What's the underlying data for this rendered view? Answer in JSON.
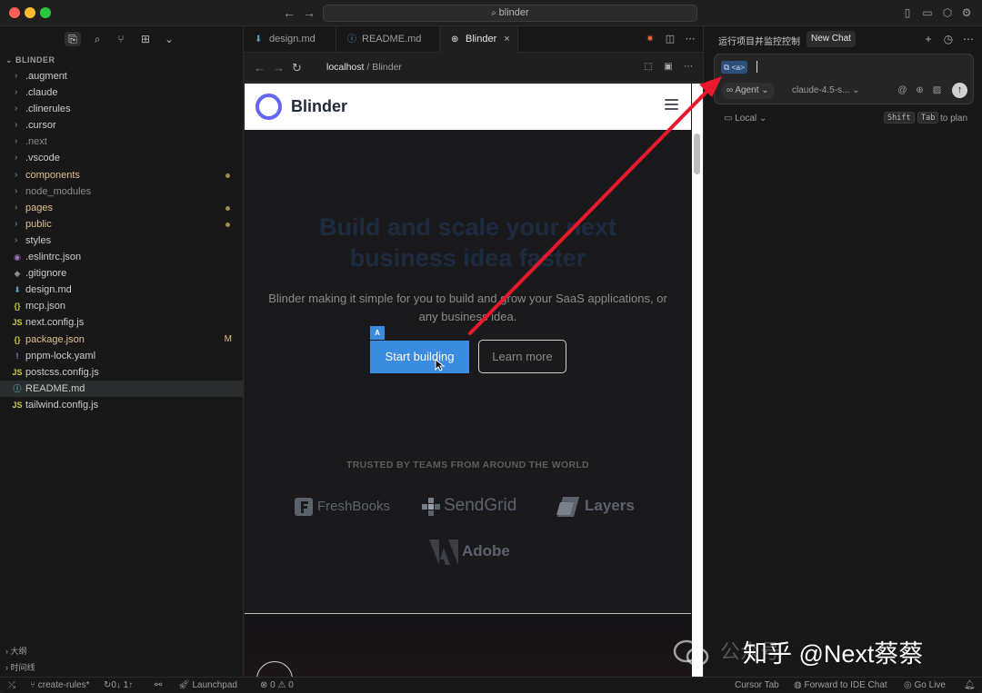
{
  "titlebar": {
    "search_text": "blinder"
  },
  "sidebar": {
    "header": "BLINDER",
    "items": [
      {
        "label": ".augment",
        "kind": "folder",
        "state": ""
      },
      {
        "label": ".claude",
        "kind": "folder",
        "state": ""
      },
      {
        "label": ".clinerules",
        "kind": "folder",
        "state": ""
      },
      {
        "label": ".cursor",
        "kind": "folder",
        "state": ""
      },
      {
        "label": ".next",
        "kind": "folder",
        "state": "dim"
      },
      {
        "label": ".vscode",
        "kind": "folder",
        "state": ""
      },
      {
        "label": "components",
        "kind": "folder",
        "state": "mod"
      },
      {
        "label": "node_modules",
        "kind": "folder",
        "state": "dim"
      },
      {
        "label": "pages",
        "kind": "folder",
        "state": "mod"
      },
      {
        "label": "public",
        "kind": "folder",
        "state": "mod"
      },
      {
        "label": "styles",
        "kind": "folder",
        "state": ""
      },
      {
        "label": ".eslintrc.json",
        "kind": "file",
        "icon": "◉",
        "icon_color": "#a074c4",
        "state": ""
      },
      {
        "label": ".gitignore",
        "kind": "file",
        "icon": "◆",
        "icon_color": "#8b8b8b",
        "state": ""
      },
      {
        "label": "design.md",
        "kind": "file",
        "icon": "⬇",
        "icon_color": "#519aba",
        "state": ""
      },
      {
        "label": "mcp.json",
        "kind": "file",
        "icon": "{}",
        "icon_color": "#cbcb41",
        "state": ""
      },
      {
        "label": "next.config.js",
        "kind": "file",
        "icon": "JS",
        "icon_color": "#cbcb41",
        "state": ""
      },
      {
        "label": "package.json",
        "kind": "file",
        "icon": "{}",
        "icon_color": "#cbcb41",
        "state": "mod"
      },
      {
        "label": "pnpm-lock.yaml",
        "kind": "file",
        "icon": "!",
        "icon_color": "#a074c4",
        "state": ""
      },
      {
        "label": "postcss.config.js",
        "kind": "file",
        "icon": "JS",
        "icon_color": "#cbcb41",
        "state": ""
      },
      {
        "label": "README.md",
        "kind": "file",
        "icon": "ⓘ",
        "icon_color": "#519aba",
        "state": "selected"
      },
      {
        "label": "tailwind.config.js",
        "kind": "file",
        "icon": "JS",
        "icon_color": "#cbcb41",
        "state": ""
      }
    ],
    "mod_badge": "M",
    "bottom": {
      "outline": "大纲",
      "timeline": "时间线"
    }
  },
  "editor": {
    "tabs": [
      {
        "label": "design.md",
        "icon": "⬇"
      },
      {
        "label": "README.md",
        "icon": "ⓘ"
      },
      {
        "label": "Blinder",
        "icon": "⊕"
      }
    ],
    "url_host": "localhost",
    "url_sep": "/",
    "url_page": "Blinder"
  },
  "site": {
    "logo": "Blinder",
    "hero_title_line1": "Build and scale your next",
    "hero_title_line2": "business idea faster",
    "hero_subtitle": "Blinder making it simple for you to build and grow your SaaS applications, or any business idea.",
    "start_button": "Start building",
    "start_tag": "A",
    "learn_button": "Learn more",
    "trusted": "TRUSTED BY TEAMS FROM AROUND THE WORLD",
    "brands": [
      "FreshBooks",
      "SendGrid",
      "Layers",
      "Adobe"
    ]
  },
  "chat": {
    "title": "运行项目并监控控制",
    "new_chat": "New Chat",
    "context_chip": "<a>",
    "agent_label": "Agent",
    "model_label": "claude-4.5-s...",
    "local_label": "Local",
    "kbd_shift": "Shift",
    "kbd_tab": "Tab",
    "to_plan": "to plan"
  },
  "statusbar": {
    "branch": "create-rules*",
    "sync": "0↓ 1↑",
    "launchpad": "Launchpad",
    "problems": "⊗ 0 ⚠ 0",
    "cursor_tab": "Cursor Tab",
    "forward": "Forward to IDE Chat",
    "go_live": "Go Live"
  },
  "watermark": {
    "dim_text": "公众号",
    "main_text": "知乎 @Next蔡蔡"
  },
  "colors": {
    "accent_blue": "#3b8be0",
    "logo_purple": "#6366f1",
    "annotation_red": "#e8192c",
    "modified_yellow": "#e2c08d"
  }
}
